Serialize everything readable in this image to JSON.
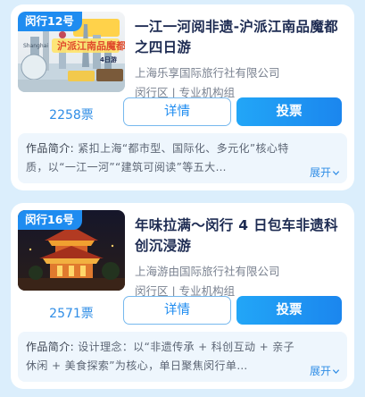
{
  "items": [
    {
      "badge": "闵行12号",
      "title": "一江一河阅非遗-沪派江南品魔都之四日游",
      "org": "上海乐享国际旅行社有限公司",
      "meta": "闵行区 | 专业机构组",
      "votes": "2258票",
      "detail_label": "详情",
      "vote_label": "投票",
      "intro_label": "作品简介:",
      "intro": "紧扣上海“都市型、国际化、多元化”核心特质，以“一江一河”“建筑可阅读”等五大…",
      "expand_label": "展开",
      "thumb": {
        "caption": "沪派江南品魔都",
        "sub": "4日游",
        "english": "Shanghai"
      }
    },
    {
      "badge": "闵行16号",
      "title": "年味拉满～闵行 4 日包车非遗科创沉浸游",
      "org": "上海游由国际旅行社有限公司",
      "meta": "闵行区 | 专业机构组",
      "votes": "2571票",
      "detail_label": "详情",
      "vote_label": "投票",
      "intro_label": "作品简介:",
      "intro": "设计理念：以“非遗传承 + 科创互动 + 亲子休闲 + 美食探索”为核心，单日聚焦闵行单…",
      "expand_label": "展开"
    }
  ],
  "colors": {
    "accent": "#1f8cf0",
    "background": "#dbeefc",
    "title": "#1d2b52",
    "muted": "#7a8290"
  }
}
